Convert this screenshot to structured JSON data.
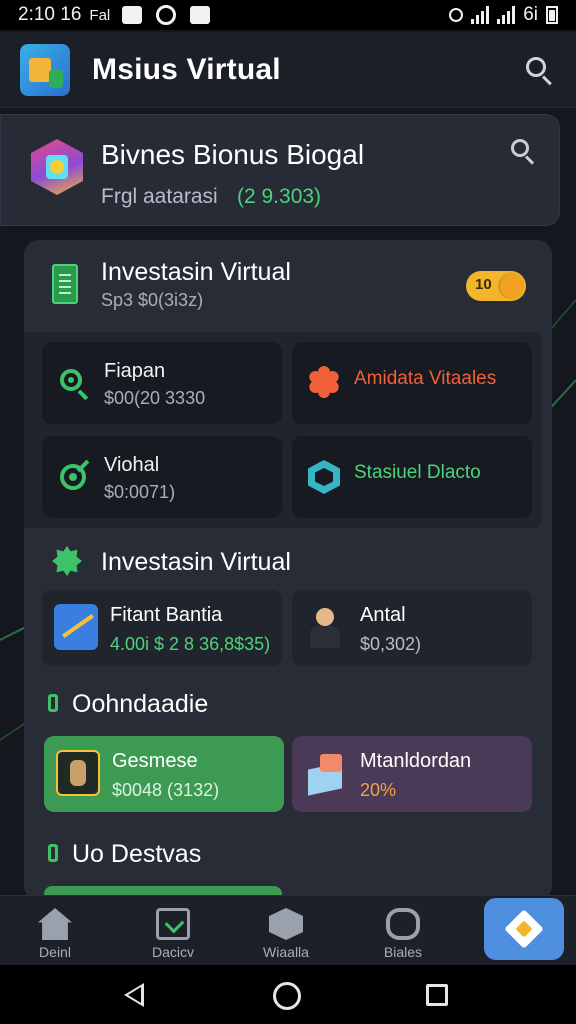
{
  "status_bar": {
    "time": "2:10 16",
    "carrier": "Fal",
    "signal_label": "6i"
  },
  "app_bar": {
    "title": "Msius Virtual"
  },
  "balance": {
    "title": "Bivnes Bionus Biogal",
    "subtitle": "Frgl aatarasi",
    "amount": "(2 9.303)"
  },
  "panel": {
    "title": "Investasin Virtual",
    "subtitle": "Sp3 $0(3i3z)",
    "toggle_label": "10"
  },
  "tiles": [
    {
      "label": "Fiapan",
      "value": "$00(20 3330",
      "icon": "search-icon"
    },
    {
      "label": "Amidata Vitaales",
      "value": "",
      "icon": "burst-icon",
      "accent": "#f2603a"
    },
    {
      "label": "Viohal",
      "value": "$0:0071)",
      "icon": "target-icon"
    },
    {
      "label": "Stasiuel Dlacto",
      "value": "",
      "icon": "hex-icon",
      "accent": "#4cd37b"
    }
  ],
  "section_invest": {
    "title": "Investasin Virtual",
    "cards": [
      {
        "label": "Fitant Bantia",
        "value": "4.00i $ 2 8 36,8$35)",
        "value_color": "#4cd37b"
      },
      {
        "label": "Antal",
        "value": "$0,302)",
        "value_color": "#b8bec9"
      }
    ]
  },
  "section_orders": {
    "title": "Oohndaadie",
    "cards": [
      {
        "label": "Gesmese",
        "value": "$0048 (3132)",
        "value_color": "#d8f5df"
      },
      {
        "label": "Mtanldordan",
        "value": "20%",
        "value_color": "#f2a04a"
      }
    ]
  },
  "section_deals": {
    "title": "Uo Destvas"
  },
  "bottom_nav": [
    {
      "label": "Deinl",
      "icon": "home-icon"
    },
    {
      "label": "Dacicv",
      "icon": "deals-icon"
    },
    {
      "label": "Wiaalla",
      "icon": "wallet-icon"
    },
    {
      "label": "Biales",
      "icon": "stats-icon"
    }
  ]
}
